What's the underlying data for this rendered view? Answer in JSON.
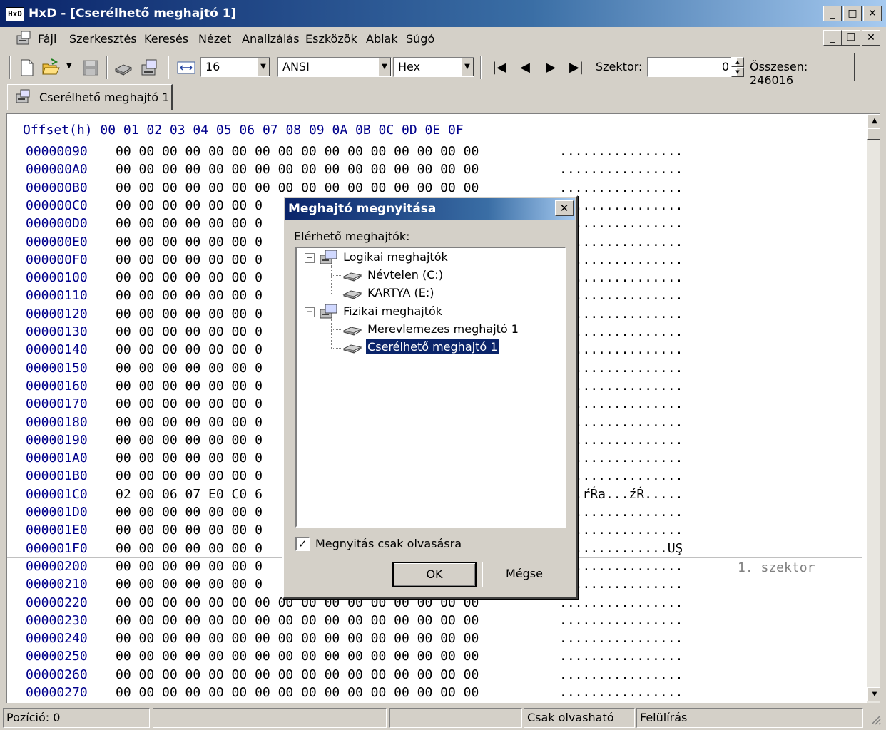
{
  "window": {
    "title": "HxD - [Cserélhető meghajtó 1]",
    "app_icon": "HxD",
    "min": "_",
    "max": "□",
    "close": "✕"
  },
  "menu": {
    "items": [
      "Fájl",
      "Szerkesztés",
      "Keresés",
      "Nézet",
      "Analizálás",
      "Eszközök",
      "Ablak",
      "Súgó"
    ],
    "mdi_min": "_",
    "mdi_restore": "❐",
    "mdi_close": "✕"
  },
  "toolbar": {
    "bytes_per_row": "16",
    "charset": "ANSI",
    "offset_base": "Hex",
    "sector_label": "Szektor:",
    "sector_value": "0",
    "total_label": "Összesen: 246016",
    "nav": {
      "first": "|◀",
      "prev": "◀",
      "next": "▶",
      "last": "▶|"
    },
    "spin_up": "▲",
    "spin_down": "▼",
    "combo_arrow": "▼"
  },
  "tab": {
    "label": "Cserélhető meghajtó 1"
  },
  "hex": {
    "header": "Offset(h) 00 01 02 03 04 05 06 07 08 09 0A 0B 0C 0D 0E 0F",
    "rows": [
      {
        "offset": "00000090",
        "bytes": "00 00 00 00 00 00 00 00 00 00 00 00 00 00 00 00",
        "ascii": "................"
      },
      {
        "offset": "000000A0",
        "bytes": "00 00 00 00 00 00 00 00 00 00 00 00 00 00 00 00",
        "ascii": "................"
      },
      {
        "offset": "000000B0",
        "bytes": "00 00 00 00 00 00 00 00 00 00 00 00 00 00 00 00",
        "ascii": "................"
      },
      {
        "offset": "000000C0",
        "bytes": "00 00 00 00 00 00 0",
        "ascii": "................"
      },
      {
        "offset": "000000D0",
        "bytes": "00 00 00 00 00 00 0",
        "ascii": "................"
      },
      {
        "offset": "000000E0",
        "bytes": "00 00 00 00 00 00 0",
        "ascii": "................"
      },
      {
        "offset": "000000F0",
        "bytes": "00 00 00 00 00 00 0",
        "ascii": "................"
      },
      {
        "offset": "00000100",
        "bytes": "00 00 00 00 00 00 0",
        "ascii": "................"
      },
      {
        "offset": "00000110",
        "bytes": "00 00 00 00 00 00 0",
        "ascii": "................"
      },
      {
        "offset": "00000120",
        "bytes": "00 00 00 00 00 00 0",
        "ascii": "................"
      },
      {
        "offset": "00000130",
        "bytes": "00 00 00 00 00 00 0",
        "ascii": "................"
      },
      {
        "offset": "00000140",
        "bytes": "00 00 00 00 00 00 0",
        "ascii": "................"
      },
      {
        "offset": "00000150",
        "bytes": "00 00 00 00 00 00 0",
        "ascii": "................"
      },
      {
        "offset": "00000160",
        "bytes": "00 00 00 00 00 00 0",
        "ascii": "................"
      },
      {
        "offset": "00000170",
        "bytes": "00 00 00 00 00 00 0",
        "ascii": "................"
      },
      {
        "offset": "00000180",
        "bytes": "00 00 00 00 00 00 0",
        "ascii": "................"
      },
      {
        "offset": "00000190",
        "bytes": "00 00 00 00 00 00 0",
        "ascii": "................"
      },
      {
        "offset": "000001A0",
        "bytes": "00 00 00 00 00 00 0",
        "ascii": "................"
      },
      {
        "offset": "000001B0",
        "bytes": "00 00 00 00 00 00 0",
        "ascii": "................"
      },
      {
        "offset": "000001C0",
        "bytes": "02 00 06 07 E0 C0 6",
        "ascii": "...ŕŔa...źŔ....."
      },
      {
        "offset": "000001D0",
        "bytes": "00 00 00 00 00 00 0",
        "ascii": "................"
      },
      {
        "offset": "000001E0",
        "bytes": "00 00 00 00 00 00 0",
        "ascii": "................"
      },
      {
        "offset": "000001F0",
        "bytes": "00 00 00 00 00 00 0",
        "ascii": "..............UŞ"
      },
      {
        "offset": "00000200",
        "bytes": "00 00 00 00 00 00 0",
        "ascii": "................"
      },
      {
        "offset": "00000210",
        "bytes": "00 00 00 00 00 00 0",
        "ascii": "................"
      },
      {
        "offset": "00000220",
        "bytes": "00 00 00 00 00 00 00 00 00 00 00 00 00 00 00 00",
        "ascii": "................"
      },
      {
        "offset": "00000230",
        "bytes": "00 00 00 00 00 00 00 00 00 00 00 00 00 00 00 00",
        "ascii": "................"
      },
      {
        "offset": "00000240",
        "bytes": "00 00 00 00 00 00 00 00 00 00 00 00 00 00 00 00",
        "ascii": "................"
      },
      {
        "offset": "00000250",
        "bytes": "00 00 00 00 00 00 00 00 00 00 00 00 00 00 00 00",
        "ascii": "................"
      },
      {
        "offset": "00000260",
        "bytes": "00 00 00 00 00 00 00 00 00 00 00 00 00 00 00 00",
        "ascii": "................"
      },
      {
        "offset": "00000270",
        "bytes": "00 00 00 00 00 00 00 00 00 00 00 00 00 00 00 00",
        "ascii": "................"
      }
    ],
    "sector_marker": "1. szektor"
  },
  "scrollbar": {
    "up": "▲",
    "down": "▼"
  },
  "status": {
    "position": "Pozíció: 0",
    "mode_readonly": "Csak olvasható",
    "mode_overwrite": "Felülírás"
  },
  "dialog": {
    "title": "Meghajtó megnyitása",
    "close": "✕",
    "available_label": "Elérhető meghajtók:",
    "tree": {
      "logical": "Logikai meghajtók",
      "logical_items": [
        "Névtelen (C:)",
        "KARTYA (E:)"
      ],
      "physical": "Fizikai meghajtók",
      "physical_items": [
        "Merevlemezes meghajtó 1",
        "Cserélhető meghajtó 1"
      ],
      "collapse_glyph": "−"
    },
    "readonly_checkbox_label": "Megnyitás csak olvasásra",
    "readonly_checked": "✓",
    "ok": "OK",
    "cancel": "Mégse"
  }
}
